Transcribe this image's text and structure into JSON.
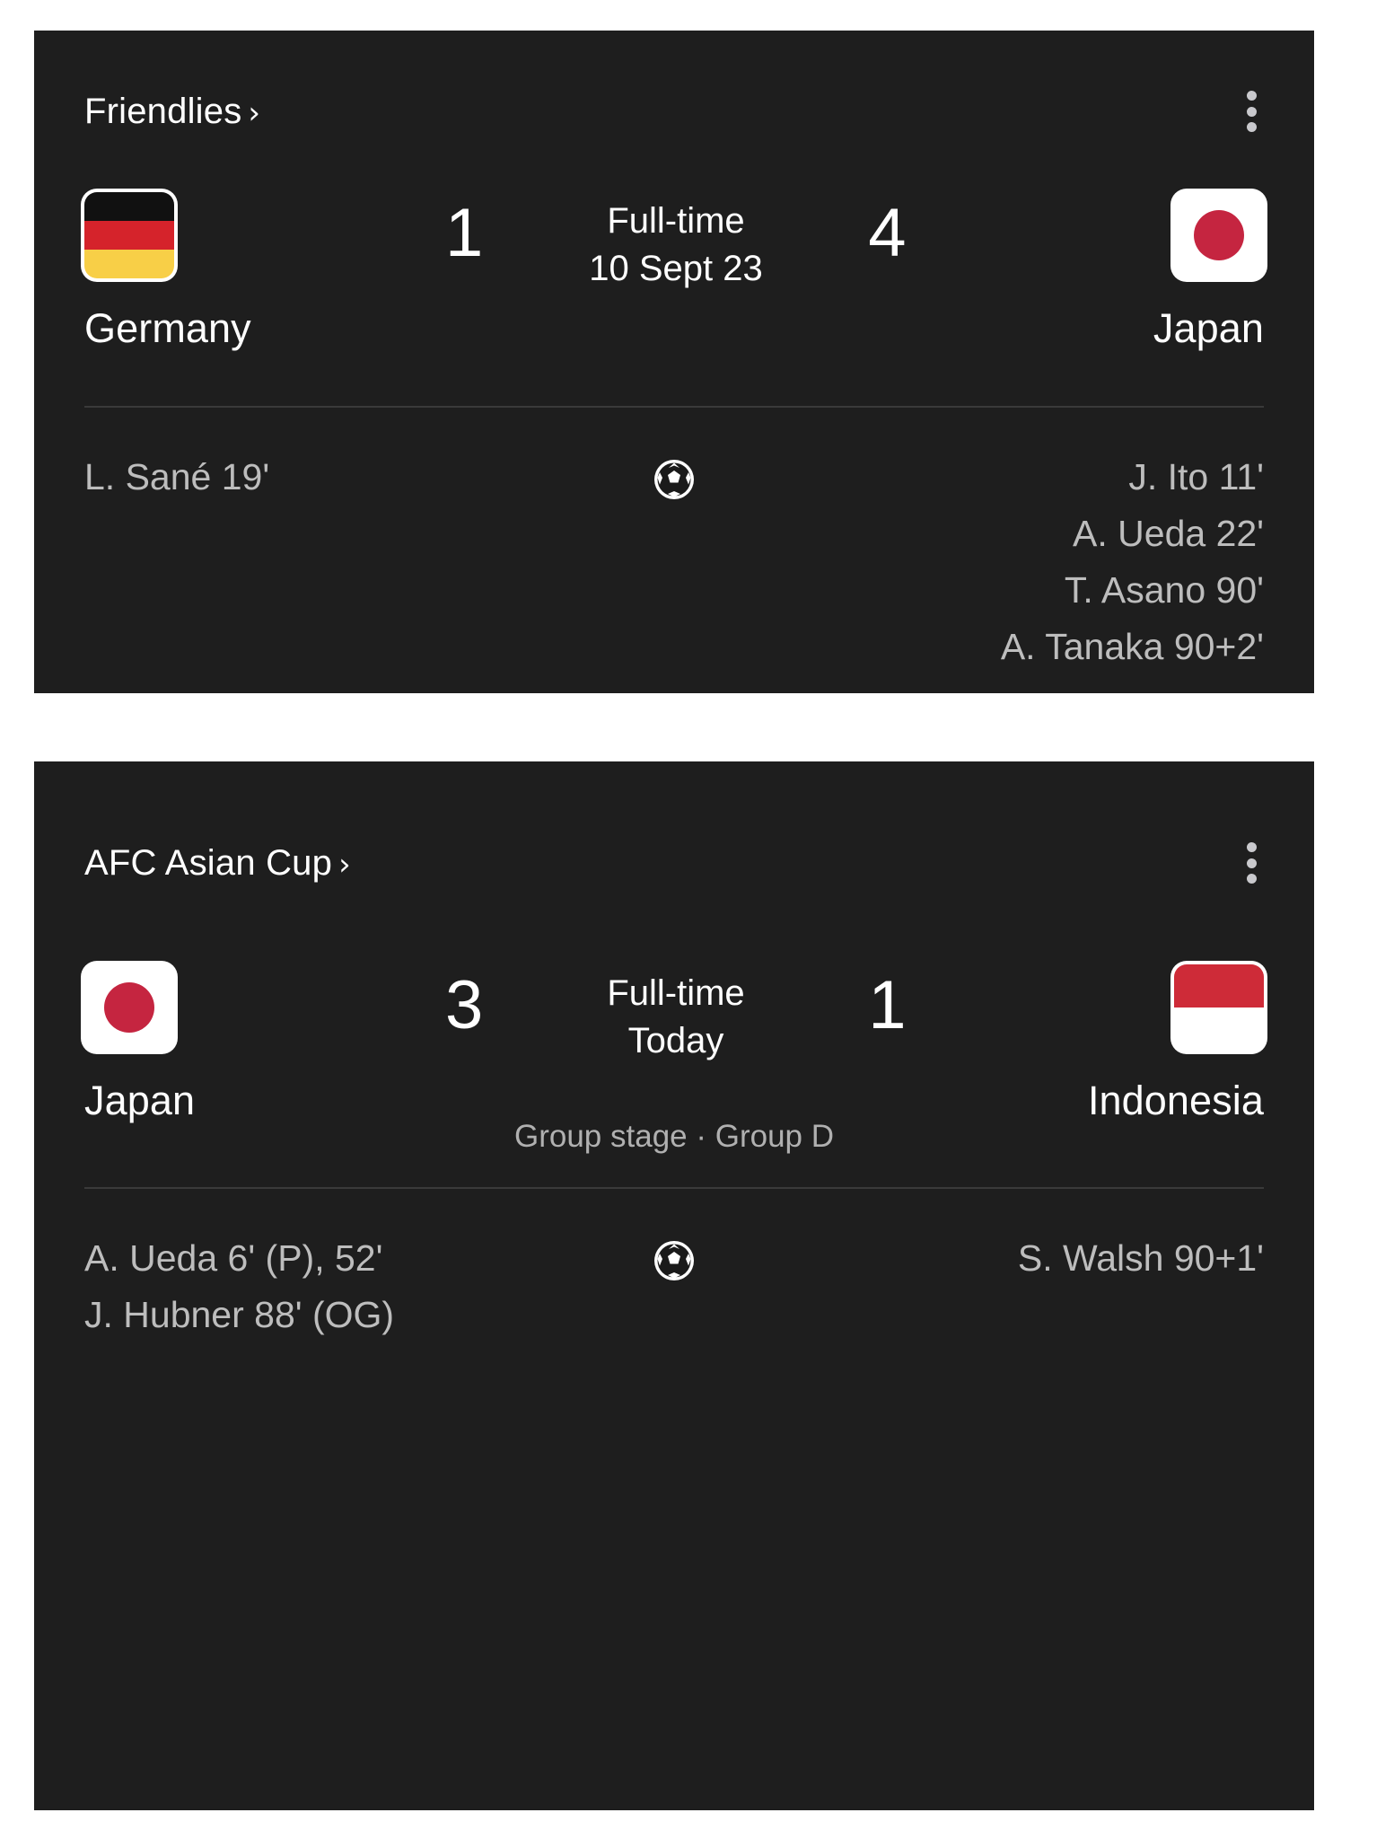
{
  "page": {
    "background": "#ffffff",
    "card_background": "#1e1e1e"
  },
  "cards": [
    {
      "id": "friendlies",
      "competition": "Friendlies",
      "chevron": "›",
      "menu_icon": "kebab-menu-icon",
      "status": "Full-time",
      "date": "10 Sept 23",
      "stage": "",
      "home": {
        "name": "Germany",
        "score": "1",
        "flag": "germany-flag-icon"
      },
      "away": {
        "name": "Japan",
        "score": "4",
        "flag": "japan-flag-icon"
      },
      "goal_icon": "soccer-ball-icon",
      "home_scorers": [
        "L. Sané 19'"
      ],
      "away_scorers": [
        "J. Ito 11'",
        "A. Ueda 22'",
        "T. Asano 90'",
        "A. Tanaka 90+2'"
      ]
    },
    {
      "id": "afc-asian-cup",
      "competition": "AFC Asian Cup",
      "chevron": "›",
      "menu_icon": "kebab-menu-icon",
      "status": "Full-time",
      "date": "Today",
      "stage": "Group stage · Group D",
      "home": {
        "name": "Japan",
        "score": "3",
        "flag": "japan-flag-icon"
      },
      "away": {
        "name": "Indonesia",
        "score": "1",
        "flag": "indonesia-flag-icon"
      },
      "goal_icon": "soccer-ball-icon",
      "home_scorers": [
        "A. Ueda 6' (P), 52'",
        "J. Hubner 88' (OG)"
      ],
      "away_scorers": [
        "S. Walsh 90+1'"
      ]
    }
  ],
  "colors": {
    "card_bg": "#1e1e1e",
    "primary_text": "#ffffff",
    "secondary_text": "#bdbdbd",
    "divider": "#3a3a3a",
    "germany_black": "#111111",
    "germany_red": "#d5232b",
    "germany_gold": "#f8cf47",
    "japan_red": "#c52540",
    "indonesia_red": "#ce2b38"
  }
}
